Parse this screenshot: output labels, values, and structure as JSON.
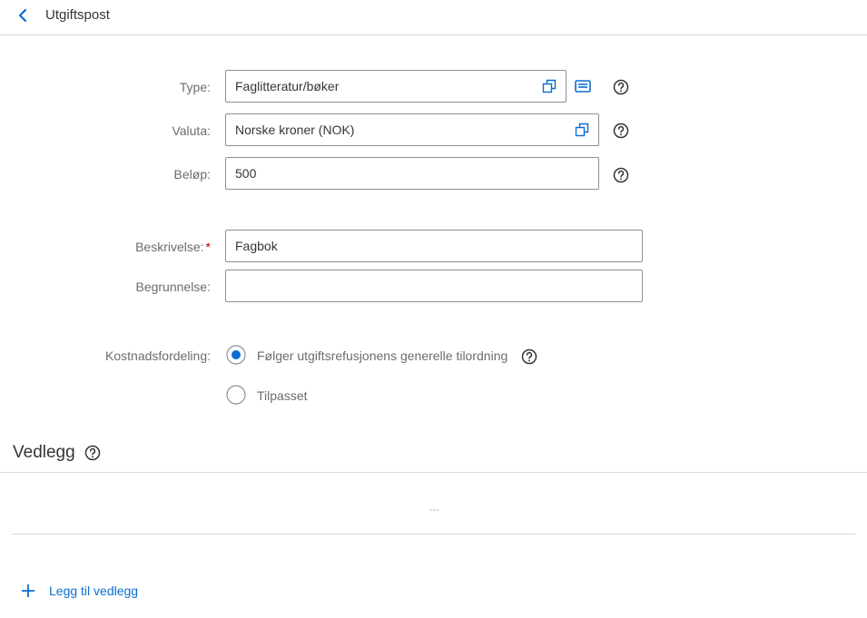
{
  "header": {
    "title": "Utgiftspost"
  },
  "form": {
    "type": {
      "label": "Type:",
      "value": "Faglitteratur/bøker"
    },
    "currency": {
      "label": "Valuta:",
      "value": "Norske kroner (NOK)"
    },
    "amount": {
      "label": "Beløp:",
      "value": "500"
    },
    "description": {
      "label": "Beskrivelse:",
      "required_marker": "*",
      "value": "Fagbok"
    },
    "justification": {
      "label": "Begrunnelse:",
      "value": ""
    },
    "cost_allocation": {
      "label": "Kostnadsfordeling:",
      "options": [
        {
          "label": "Følger utgiftsrefusjonens generelle tilordning",
          "selected": true
        },
        {
          "label": "Tilpasset",
          "selected": false
        }
      ]
    }
  },
  "attachments": {
    "title": "Vedlegg",
    "empty_placeholder": "---",
    "add_label": "Legg til vedlegg"
  },
  "colors": {
    "accent": "#0a6ed1",
    "required": "#bb0000",
    "label": "#6a6d70"
  }
}
